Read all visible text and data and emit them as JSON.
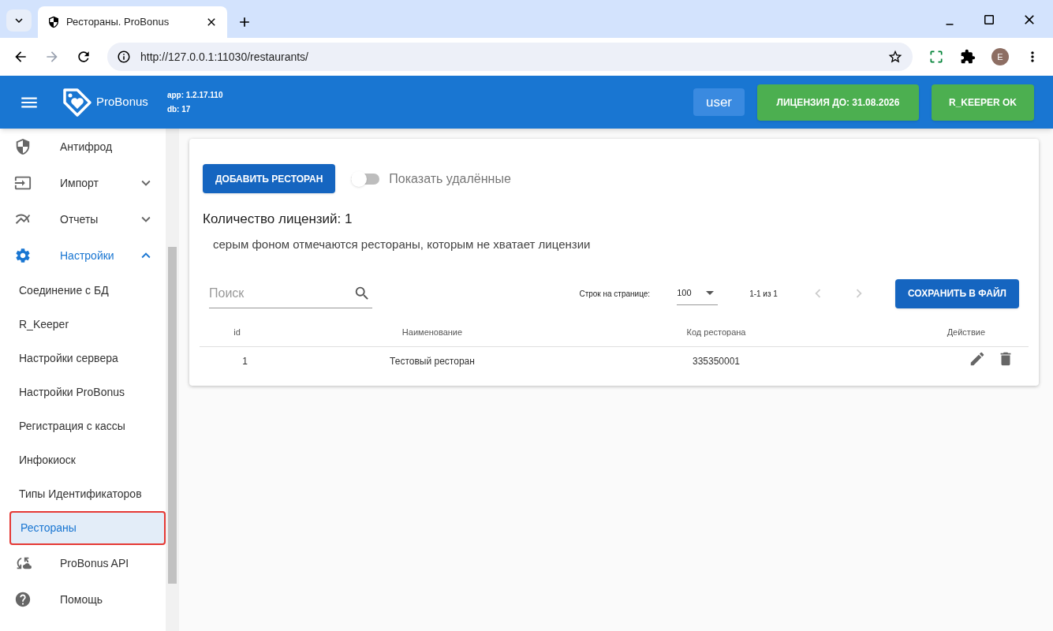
{
  "browser": {
    "tab_title": "Рестораны. ProBonus",
    "url": "http://127.0.0.1:11030/restaurants/",
    "avatar_letter": "E"
  },
  "header": {
    "logo_text": "ProBonus",
    "app_version": "app: 1.2.17.110",
    "db_version": "db: 17",
    "user": "user",
    "license": "ЛИЦЕНЗИЯ ДО: 31.08.2026",
    "rkeeper": "R_KEEPER OK"
  },
  "sidebar": {
    "items": [
      {
        "label": "Антифрод"
      },
      {
        "label": "Импорт",
        "expanded": false
      },
      {
        "label": "Отчеты",
        "expanded": false
      },
      {
        "label": "Настройки",
        "expanded": true,
        "children": [
          {
            "label": "Соединение с БД",
            "selected": false
          },
          {
            "label": "R_Keeper",
            "selected": false
          },
          {
            "label": "Настройки сервера",
            "selected": false
          },
          {
            "label": "Настройки ProBonus",
            "selected": false
          },
          {
            "label": "Регистрация с кассы",
            "selected": false
          },
          {
            "label": "Инфокиоск",
            "selected": false
          },
          {
            "label": "Типы Идентификаторов",
            "selected": false
          },
          {
            "label": "Рестораны",
            "selected": true
          }
        ]
      },
      {
        "label": "ProBonus API"
      },
      {
        "label": "Помощь"
      }
    ]
  },
  "content": {
    "add_button": "ДОБАВИТЬ РЕСТОРАН",
    "toggle": {
      "label": "Показать удалённые",
      "on": false
    },
    "license_count": "Количество лицензий: 1",
    "note": "серым фоном отмечаются рестораны, которым не хватает лицензии",
    "search": {
      "placeholder": "Поиск"
    },
    "pagination": {
      "rows_label": "Строк на странице:",
      "rows_value": "100",
      "range": "1-1 из 1"
    },
    "save_button": "СОХРАНИТЬ В ФАЙЛ",
    "table": {
      "columns": [
        "id",
        "Наименование",
        "Код ресторана",
        "Действие"
      ],
      "rows": [
        {
          "cells": [
            "1",
            "Тестовый ресторан",
            "335350001"
          ]
        }
      ]
    }
  }
}
